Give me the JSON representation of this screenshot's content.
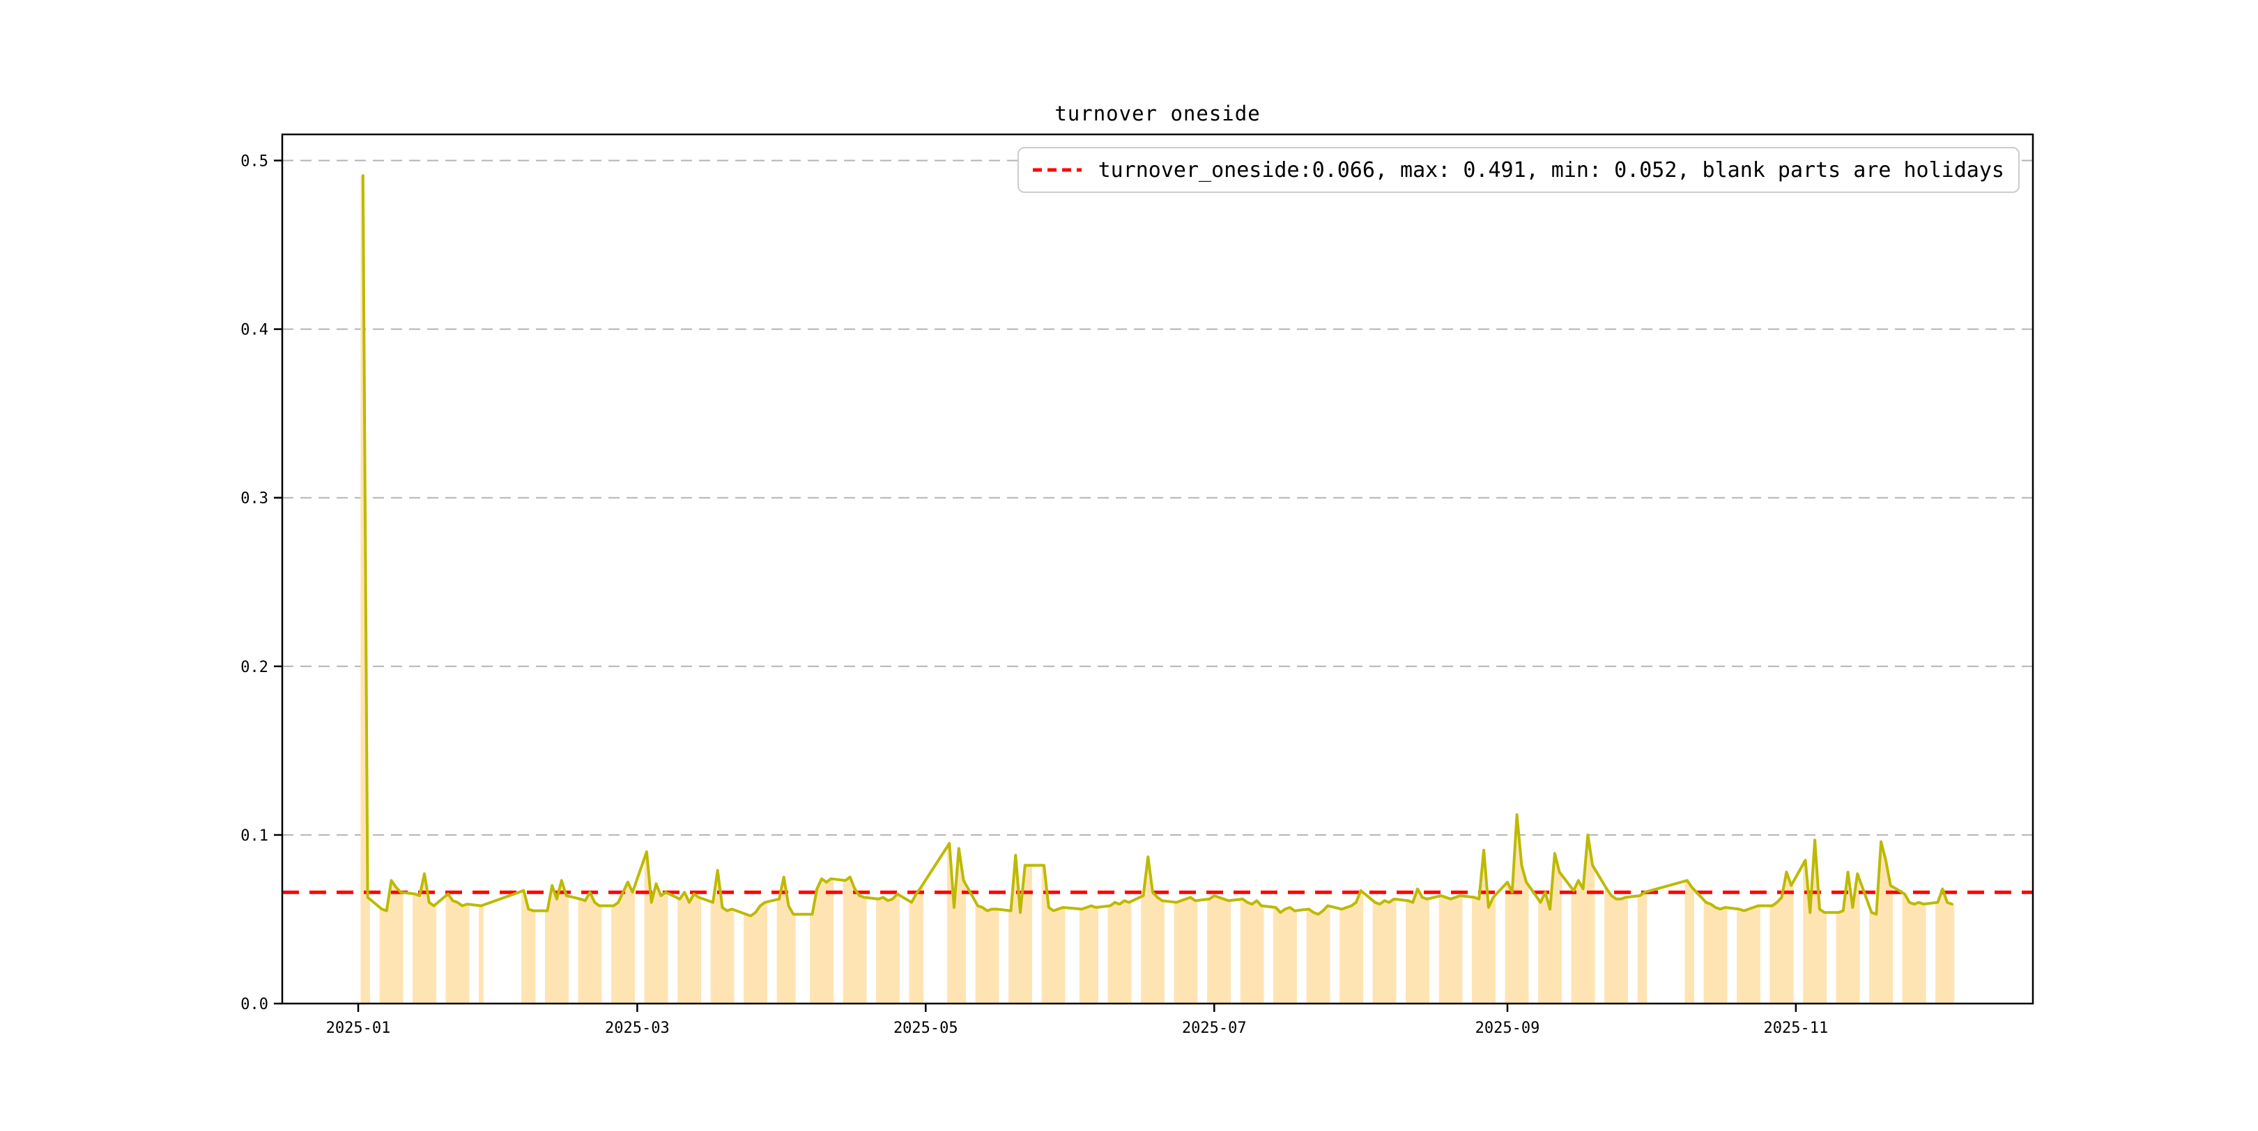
{
  "figure": {
    "title": "turnover oneside",
    "background": "#ffffff"
  },
  "legend": {
    "label": "turnover_oneside:0.066, max: 0.491, min: 0.052, blank parts are holidays",
    "marker_color": "#ff0000",
    "position": "upper right"
  },
  "chart_data": {
    "type": "line",
    "title": "turnover oneside",
    "note": "blank parts are holidays",
    "stats": {
      "turnover_oneside": 0.066,
      "max": 0.491,
      "min": 0.052
    },
    "reference_line": {
      "value": 0.066,
      "color": "#ff0000",
      "style": "dashed"
    },
    "grid": {
      "axis": "y",
      "style": "dashed",
      "color": "#b3b3b3"
    },
    "x_axis": {
      "tick_labels": [
        "2025-01",
        "2025-03",
        "2025-05",
        "2025-07",
        "2025-09",
        "2025-11"
      ],
      "range": [
        "2024-12-16",
        "2025-12-21"
      ]
    },
    "y_axis": {
      "tick_labels": [
        "0.0",
        "0.1",
        "0.2",
        "0.3",
        "0.4",
        "0.5"
      ],
      "tick_values": [
        0.0,
        0.1,
        0.2,
        0.3,
        0.4,
        0.5
      ],
      "range": [
        0.0,
        0.5155
      ]
    },
    "series": [
      {
        "name": "turnover_oneside",
        "color": "#bcba00",
        "fill_color": "#ffe4b3",
        "dates": [
          "2025-01-02",
          "2025-01-03",
          "2025-01-06",
          "2025-01-07",
          "2025-01-08",
          "2025-01-09",
          "2025-01-10",
          "2025-01-13",
          "2025-01-14",
          "2025-01-15",
          "2025-01-16",
          "2025-01-17",
          "2025-01-20",
          "2025-01-21",
          "2025-01-22",
          "2025-01-23",
          "2025-01-24",
          "2025-01-27",
          "2025-02-05",
          "2025-02-06",
          "2025-02-07",
          "2025-02-10",
          "2025-02-11",
          "2025-02-12",
          "2025-02-13",
          "2025-02-14",
          "2025-02-17",
          "2025-02-18",
          "2025-02-19",
          "2025-02-20",
          "2025-02-21",
          "2025-02-24",
          "2025-02-25",
          "2025-02-26",
          "2025-02-27",
          "2025-02-28",
          "2025-03-03",
          "2025-03-04",
          "2025-03-05",
          "2025-03-06",
          "2025-03-07",
          "2025-03-10",
          "2025-03-11",
          "2025-03-12",
          "2025-03-13",
          "2025-03-14",
          "2025-03-17",
          "2025-03-18",
          "2025-03-19",
          "2025-03-20",
          "2025-03-21",
          "2025-03-24",
          "2025-03-25",
          "2025-03-26",
          "2025-03-27",
          "2025-03-28",
          "2025-03-31",
          "2025-04-01",
          "2025-04-02",
          "2025-04-03",
          "2025-04-07",
          "2025-04-08",
          "2025-04-09",
          "2025-04-10",
          "2025-04-11",
          "2025-04-14",
          "2025-04-15",
          "2025-04-16",
          "2025-04-17",
          "2025-04-18",
          "2025-04-21",
          "2025-04-22",
          "2025-04-23",
          "2025-04-24",
          "2025-04-25",
          "2025-04-28",
          "2025-04-29",
          "2025-04-30",
          "2025-05-06",
          "2025-05-07",
          "2025-05-08",
          "2025-05-09",
          "2025-05-12",
          "2025-05-13",
          "2025-05-14",
          "2025-05-15",
          "2025-05-16",
          "2025-05-19",
          "2025-05-20",
          "2025-05-21",
          "2025-05-22",
          "2025-05-23",
          "2025-05-26",
          "2025-05-27",
          "2025-05-28",
          "2025-05-29",
          "2025-05-30",
          "2025-06-03",
          "2025-06-04",
          "2025-06-05",
          "2025-06-06",
          "2025-06-09",
          "2025-06-10",
          "2025-06-11",
          "2025-06-12",
          "2025-06-13",
          "2025-06-16",
          "2025-06-17",
          "2025-06-18",
          "2025-06-19",
          "2025-06-20",
          "2025-06-23",
          "2025-06-24",
          "2025-06-25",
          "2025-06-26",
          "2025-06-27",
          "2025-06-30",
          "2025-07-01",
          "2025-07-02",
          "2025-07-03",
          "2025-07-04",
          "2025-07-07",
          "2025-07-08",
          "2025-07-09",
          "2025-07-10",
          "2025-07-11",
          "2025-07-14",
          "2025-07-15",
          "2025-07-16",
          "2025-07-17",
          "2025-07-18",
          "2025-07-21",
          "2025-07-22",
          "2025-07-23",
          "2025-07-24",
          "2025-07-25",
          "2025-07-28",
          "2025-07-29",
          "2025-07-30",
          "2025-07-31",
          "2025-08-01",
          "2025-08-04",
          "2025-08-05",
          "2025-08-06",
          "2025-08-07",
          "2025-08-08",
          "2025-08-11",
          "2025-08-12",
          "2025-08-13",
          "2025-08-14",
          "2025-08-15",
          "2025-08-18",
          "2025-08-19",
          "2025-08-20",
          "2025-08-21",
          "2025-08-22",
          "2025-08-25",
          "2025-08-26",
          "2025-08-27",
          "2025-08-28",
          "2025-08-29",
          "2025-09-01",
          "2025-09-02",
          "2025-09-03",
          "2025-09-04",
          "2025-09-05",
          "2025-09-08",
          "2025-09-09",
          "2025-09-10",
          "2025-09-11",
          "2025-09-12",
          "2025-09-15",
          "2025-09-16",
          "2025-09-17",
          "2025-09-18",
          "2025-09-19",
          "2025-09-22",
          "2025-09-23",
          "2025-09-24",
          "2025-09-25",
          "2025-09-26",
          "2025-09-29",
          "2025-09-30",
          "2025-10-09",
          "2025-10-10",
          "2025-10-13",
          "2025-10-14",
          "2025-10-15",
          "2025-10-16",
          "2025-10-17",
          "2025-10-20",
          "2025-10-21",
          "2025-10-22",
          "2025-10-23",
          "2025-10-24",
          "2025-10-27",
          "2025-10-28",
          "2025-10-29",
          "2025-10-30",
          "2025-10-31",
          "2025-11-03",
          "2025-11-04",
          "2025-11-05",
          "2025-11-06",
          "2025-11-07",
          "2025-11-10",
          "2025-11-11",
          "2025-11-12",
          "2025-11-13",
          "2025-11-14",
          "2025-11-17",
          "2025-11-18",
          "2025-11-19",
          "2025-11-20",
          "2025-11-21",
          "2025-11-24",
          "2025-11-25",
          "2025-11-26",
          "2025-11-27",
          "2025-11-28",
          "2025-12-01",
          "2025-12-02",
          "2025-12-03",
          "2025-12-04"
        ],
        "values": [
          0.491,
          0.063,
          0.056,
          0.055,
          0.073,
          0.069,
          0.066,
          0.065,
          0.064,
          0.077,
          0.06,
          0.058,
          0.065,
          0.061,
          0.06,
          0.058,
          0.059,
          0.058,
          0.067,
          0.056,
          0.055,
          0.055,
          0.07,
          0.062,
          0.073,
          0.064,
          0.062,
          0.061,
          0.066,
          0.06,
          0.058,
          0.058,
          0.06,
          0.066,
          0.072,
          0.066,
          0.09,
          0.06,
          0.071,
          0.064,
          0.066,
          0.062,
          0.066,
          0.06,
          0.065,
          0.063,
          0.06,
          0.079,
          0.057,
          0.055,
          0.056,
          0.053,
          0.052,
          0.054,
          0.058,
          0.06,
          0.062,
          0.075,
          0.058,
          0.053,
          0.053,
          0.068,
          0.074,
          0.072,
          0.074,
          0.073,
          0.075,
          0.068,
          0.064,
          0.063,
          0.062,
          0.063,
          0.061,
          0.062,
          0.065,
          0.06,
          0.065,
          0.069,
          0.095,
          0.057,
          0.092,
          0.073,
          0.058,
          0.057,
          0.055,
          0.056,
          0.056,
          0.055,
          0.088,
          0.054,
          0.082,
          0.082,
          0.082,
          0.057,
          0.055,
          0.056,
          0.057,
          0.056,
          0.057,
          0.058,
          0.057,
          0.058,
          0.06,
          0.059,
          0.061,
          0.06,
          0.064,
          0.087,
          0.066,
          0.063,
          0.061,
          0.06,
          0.061,
          0.062,
          0.063,
          0.061,
          0.062,
          0.064,
          0.063,
          0.062,
          0.061,
          0.062,
          0.06,
          0.059,
          0.061,
          0.058,
          0.057,
          0.054,
          0.056,
          0.057,
          0.055,
          0.056,
          0.054,
          0.053,
          0.055,
          0.058,
          0.056,
          0.057,
          0.058,
          0.06,
          0.067,
          0.06,
          0.059,
          0.061,
          0.06,
          0.062,
          0.061,
          0.06,
          0.068,
          0.063,
          0.062,
          0.064,
          0.063,
          0.062,
          0.063,
          0.064,
          0.063,
          0.062,
          0.091,
          0.057,
          0.063,
          0.072,
          0.066,
          0.112,
          0.082,
          0.072,
          0.06,
          0.066,
          0.056,
          0.089,
          0.078,
          0.067,
          0.073,
          0.068,
          0.1,
          0.082,
          0.068,
          0.064,
          0.062,
          0.062,
          0.063,
          0.064,
          0.066,
          0.073,
          0.069,
          0.06,
          0.059,
          0.057,
          0.056,
          0.057,
          0.056,
          0.055,
          0.056,
          0.057,
          0.058,
          0.058,
          0.06,
          0.063,
          0.078,
          0.07,
          0.085,
          0.054,
          0.097,
          0.056,
          0.054,
          0.054,
          0.055,
          0.078,
          0.057,
          0.077,
          0.054,
          0.053,
          0.096,
          0.085,
          0.07,
          0.065,
          0.06,
          0.059,
          0.06,
          0.059,
          0.06,
          0.068,
          0.06,
          0.059
        ]
      }
    ],
    "legend_entries": [
      "turnover_oneside:0.066, max: 0.491, min: 0.052, blank parts are holidays"
    ]
  }
}
